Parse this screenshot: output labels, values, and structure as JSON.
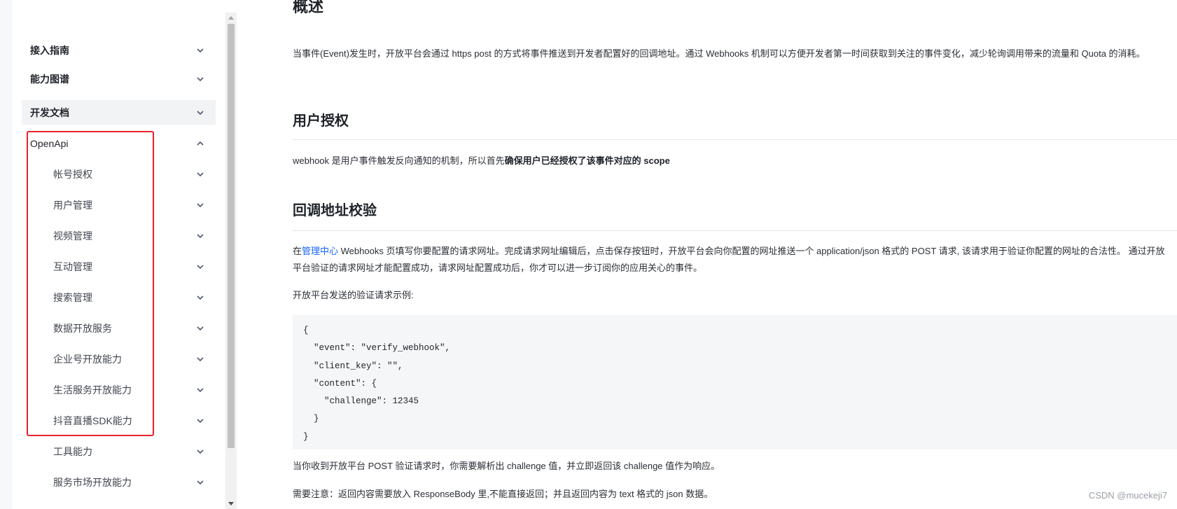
{
  "sidebar": {
    "items": [
      {
        "label": "接入指南",
        "expanded": false
      },
      {
        "label": "能力图谱",
        "expanded": false
      },
      {
        "label": "开发文档",
        "expanded": false,
        "active": true
      },
      {
        "label": "OpenApi",
        "expanded": true
      }
    ],
    "subitems": [
      {
        "label": "帐号授权"
      },
      {
        "label": "用户管理"
      },
      {
        "label": "视频管理"
      },
      {
        "label": "互动管理"
      },
      {
        "label": "搜索管理"
      },
      {
        "label": "数据开放服务"
      },
      {
        "label": "企业号开放能力"
      },
      {
        "label": "生活服务开放能力"
      },
      {
        "label": "抖音直播SDK能力"
      },
      {
        "label": "工具能力"
      },
      {
        "label": "服务市场开放能力"
      }
    ],
    "highlight_color": "#e8232b"
  },
  "content": {
    "overview_title": "概述",
    "overview_text": "当事件(Event)发生时，开放平台会通过 https post 的方式将事件推送到开发者配置好的回调地址。通过 Webhooks 机制可以方便开发者第一时间获取到关注的事件变化，减少轮询调用带来的流量和 Quota 的消耗。",
    "auth_title": "用户授权",
    "auth_text_plain": "webhook 是用户事件触发反向通知的机制，所以首先",
    "auth_text_bold": "确保用户已经授权了该事件对应的 scope",
    "verify_title": "回调地址校验",
    "verify_text_prefix": "在",
    "verify_text_link": "管理中心",
    "verify_text_rest": " Webhooks 页填写你要配置的请求网址。完成请求网址编辑后，点击保存按钮时，开放平台会向你配置的网址推送一个 application/json 格式的 POST 请求, 该请求用于验证你配置的网址的合法性。 通过开放平台验证的请求网址才能配置成功，请求网址配置成功后，你才可以进一步订阅你的应用关心的事件。",
    "example_label": "开放平台发送的验证请求示例:",
    "code_lines": [
      "{",
      "  \"event\": \"verify_webhook\",",
      "  \"client_key\": \"\",",
      "  \"content\": {",
      "    \"challenge\": 12345",
      "  }",
      "}"
    ],
    "after_code_text": "当你收到开放平台 POST 验证请求时，你需要解析出 challenge 值，并立即返回该 challenge 值作为响应。",
    "note_text": "需要注意：返回内容需要放入 ResponseBody 里,不能直接返回；并且返回内容为 text 格式的 json 数据。",
    "link_color": "#1664ff"
  },
  "watermark": "CSDN @mucekeji7",
  "icons": {
    "collapsed": "chevron-down-icon",
    "expanded": "chevron-up-icon"
  }
}
